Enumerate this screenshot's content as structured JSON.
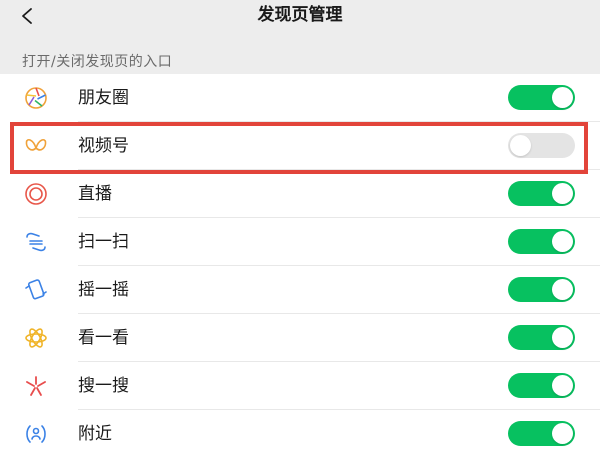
{
  "header": {
    "title": "发现页管理",
    "back_icon": "chevron-left-icon"
  },
  "section": {
    "label": "打开/关闭发现页的入口"
  },
  "items": [
    {
      "label": "朋友圈",
      "icon": "moments-aperture-icon",
      "enabled": true
    },
    {
      "label": "视频号",
      "icon": "channels-butterfly-icon",
      "enabled": false
    },
    {
      "label": "直播",
      "icon": "live-broadcast-icon",
      "enabled": true
    },
    {
      "label": "扫一扫",
      "icon": "scan-icon",
      "enabled": true
    },
    {
      "label": "摇一摇",
      "icon": "shake-phone-icon",
      "enabled": true
    },
    {
      "label": "看一看",
      "icon": "top-stories-flower-icon",
      "enabled": true
    },
    {
      "label": "搜一搜",
      "icon": "search-starburst-icon",
      "enabled": true
    },
    {
      "label": "附近",
      "icon": "nearby-icon",
      "enabled": true
    }
  ],
  "colors": {
    "toggle_on": "#07c160",
    "toggle_off": "#e4e4e4",
    "highlight": "#e2443a",
    "background_gray": "#ededed"
  }
}
